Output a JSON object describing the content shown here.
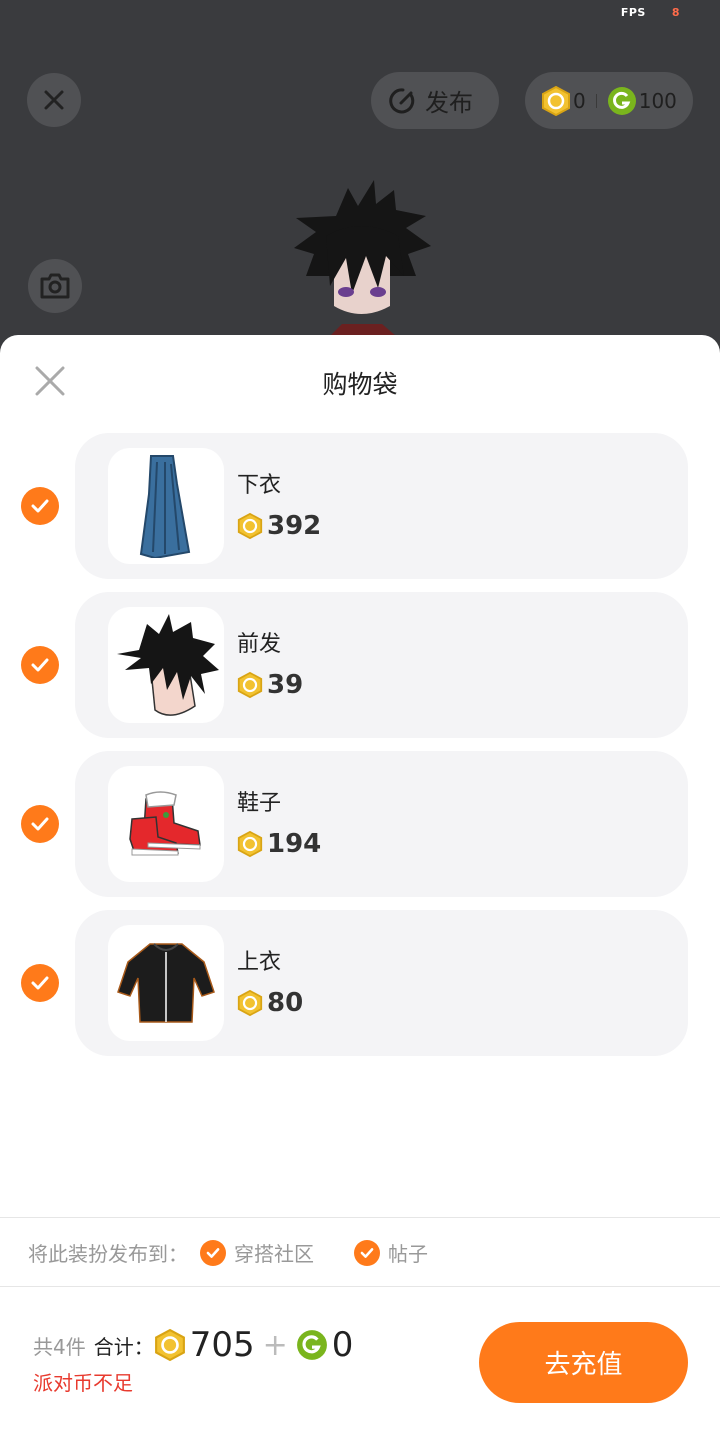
{
  "fps": {
    "label": "FPS",
    "value": "8"
  },
  "topbar": {
    "publish_label": "发布",
    "gold_coins": "0",
    "green_coins": "100"
  },
  "sheet": {
    "title": "购物袋"
  },
  "items": [
    {
      "name": "下衣",
      "price": "392",
      "icon": "skirt-icon"
    },
    {
      "name": "前发",
      "price": "39",
      "icon": "hair-icon"
    },
    {
      "name": "鞋子",
      "price": "194",
      "icon": "shoes-icon"
    },
    {
      "name": "上衣",
      "price": "80",
      "icon": "jacket-icon"
    }
  ],
  "publish_to": {
    "label": "将此装扮发布到：",
    "options": [
      "穿搭社区",
      "帖子"
    ]
  },
  "footer": {
    "count_label": "共4件",
    "sum_label": "合计：",
    "gold_total": "705",
    "plus": "+",
    "green_total": "0",
    "warning": "派对币不足",
    "recharge_label": "去充值"
  },
  "colors": {
    "accent": "#ff7a1a",
    "warning": "#e83a2e",
    "gold": "#f2c230",
    "green": "#7ab51d"
  }
}
